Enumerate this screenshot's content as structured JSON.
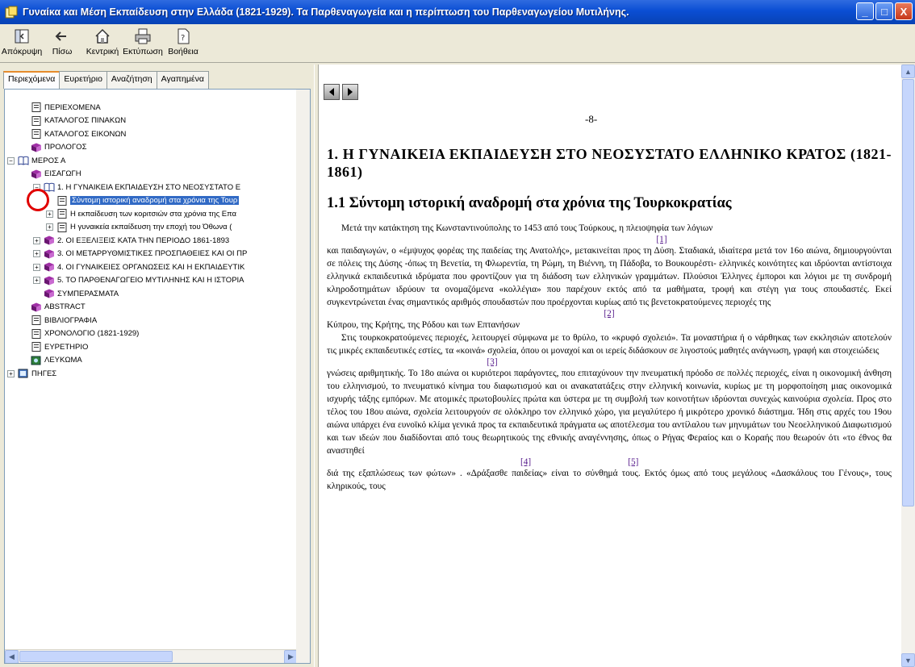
{
  "window": {
    "title": "Γυναίκα και Μέση Εκπαίδευση στην Ελλάδα (1821-1929). Τα Παρθεναγωγεία και η περίπτωση του Παρθεναγωγείου Μυτιλήνης.",
    "buttons": [
      "_",
      "□",
      "X"
    ]
  },
  "toolbar": [
    {
      "label": "Απόκρυψη",
      "icon": "hide-icon"
    },
    {
      "label": "Πίσω",
      "icon": "back-icon"
    },
    {
      "label": "Κεντρική",
      "icon": "home-icon"
    },
    {
      "label": "Εκτύπωση",
      "icon": "print-icon"
    },
    {
      "label": "Βοήθεια",
      "icon": "help-icon"
    }
  ],
  "tabs": [
    "Περιεχόμενα",
    "Ευρετήριο",
    "Αναζήτηση",
    "Αγαπημένα"
  ],
  "tree": [
    {
      "label": "ΠΕΡΙΕΧΟΜΕΝΑ",
      "icon": "page-icon"
    },
    {
      "label": "ΚΑΤΑΛΟΓΟΣ ΠΙΝΑΚΩΝ",
      "icon": "page-icon"
    },
    {
      "label": "ΚΑΤΑΛΟΓΟΣ ΕΙΚΟΝΩΝ",
      "icon": "page-icon"
    },
    {
      "label": "ΠΡΟΛΟΓΟΣ",
      "icon": "book-icon"
    },
    {
      "label": "ΜΕΡΟΣ Α",
      "icon": "open-book-icon",
      "expander": "−"
    },
    {
      "label": "ΕΙΣΑΓΩΓΗ",
      "icon": "book-icon"
    },
    {
      "label": "1. Η ΓΥΝΑΙΚΕΙΑ ΕΚΠΑΙΔΕΥΣΗ ΣΤΟ ΝΕΟΣΥΣΤΑΤΟ Ε",
      "icon": "open-book-icon",
      "expander": "−"
    },
    {
      "label": "Σύντομη ιστορική αναδρομή στα χρόνια της Τουρ",
      "icon": "page-icon",
      "selected": true
    },
    {
      "label": "Η εκπαίδευση των κοριτσιών στα χρόνια της Επα",
      "icon": "page-icon",
      "expander": "+"
    },
    {
      "label": "Η γυναικεία εκπαίδευση την εποχή του Όθωνα (",
      "icon": "page-icon",
      "expander": "+"
    },
    {
      "label": "2. ΟΙ ΕΞΕΛΙΞΕΙΣ ΚΑΤΑ ΤΗΝ ΠΕΡΙΟΔΟ 1861-1893",
      "icon": "book-icon",
      "expander": "+"
    },
    {
      "label": "3. ΟΙ ΜΕΤΑΡΡΥΘΜΙΣΤΙΚΕΣ ΠΡΟΣΠΑΘΕΙΕΣ ΚΑΙ ΟΙ ΠΡ",
      "icon": "book-icon",
      "expander": "+"
    },
    {
      "label": "4. ΟΙ ΓΥΝΑΙΚΕΙΕΣ ΟΡΓΑΝΩΣΕΙΣ ΚΑΙ Η ΕΚΠΑΙΔΕΥΤΙΚ",
      "icon": "book-icon",
      "expander": "+"
    },
    {
      "label": "5. ΤΟ ΠΑΡΘΕΝΑΓΩΓΕΙΟ ΜΥΤΙΛΗΝΗΣ ΚΑΙ Η ΙΣΤΟΡΙΑ",
      "icon": "book-icon",
      "expander": "+"
    },
    {
      "label": "ΣΥΜΠΕΡΑΣΜΑΤΑ",
      "icon": "book-icon"
    },
    {
      "label": "ABSTRACT",
      "icon": "book-icon"
    },
    {
      "label": "ΒΙΒΛΙΟΓΡΑΦΙΑ",
      "icon": "page-icon"
    },
    {
      "label": "ΧΡΟΝΟΛΟΓΙΟ (1821-1929)",
      "icon": "page-icon"
    },
    {
      "label": "ΕΥΡΕΤΗΡΙΟ",
      "icon": "page-icon"
    },
    {
      "label": "ΛΕΥΚΩΜΑ",
      "icon": "album-icon"
    },
    {
      "label": "ΠΗΓΕΣ",
      "icon": "sources-icon",
      "expander": "+"
    }
  ],
  "document": {
    "page_number": "-8-",
    "heading1": "1. Η ΓΥΝΑΙΚΕΙΑ ΕΚΠΑΙΔΕΥΣΗ ΣΤΟ ΝΕΟΣΥΣΤΑΤΟ ΕΛΛΗΝΙΚΟ ΚΡΑΤΟΣ (1821-1861)",
    "heading2": "1.1 Σύντομη ιστορική αναδρομή στα χρόνια της Τουρκοκρατίας",
    "p1": "Μετά την κατάκτηση της Κωνσταντινούπολης το 1453 από τους Τούρκους, η πλειοψηφία των λόγιων",
    "fn1": "[1]",
    "p2": "και παιδαγωγών, ο «έμψυχος φορέας της παιδείας της Ανατολής», μετακινείται προς τη Δύση. Σταδιακά, ιδιαίτερα μετά τον 16ο αιώνα, δημιουργούνται σε πόλεις της Δύσης -όπως τη Βενετία, τη Φλωρεντία, τη Ρώμη, τη Βιέννη, τη Πάδοβα, το Βουκουρέστι- ελληνικές κοινότητες και ιδρύονται αντίστοιχα ελληνικά εκπαιδευτικά ιδρύματα που φροντίζουν για τη διάδοση των ελληνικών γραμμάτων. Πλούσιοι Έλληνες έμποροι και λόγιοι με τη συνδρομή κληροδοτημάτων ιδρύουν τα ονομαζόμενα «κολλέγια» που παρέχουν εκτός από τα μαθήματα, τροφή και στέγη για τους σπουδαστές. Εκεί συγκεντρώνεται ένας σημαντικός αριθμός σπουδαστών που προέρχονται κυρίως από τις βενετοκρατούμενες περιοχές της",
    "fn2": "[2]",
    "p3": "Κύπρου, της Κρήτης, της Ρόδου και των Επτανήσων",
    "p4": "Στις τουρκοκρατούμενες περιοχές, λειτουργεί σύμφωνα με το θρύλο, το «κρυφό σχολειό». Τα μοναστήρια ή ο νάρθηκας των εκκλησιών αποτελούν τις μικρές εκπαιδευτικές εστίες, τα «κοινά» σχολεία, όπου οι μοναχοί και οι ιερείς διδάσκουν σε λιγοστούς μαθητές ανάγνωση, γραφή και στοιχειώδεις",
    "fn3": "[3]",
    "p5": "γνώσεις αριθμητικής. Το 18ο αιώνα οι κυριότεροι παράγοντες, που επιταχύνουν την πνευματική πρόοδο σε πολλές περιοχές, είναι η οικονομική άνθηση του ελληνισμού, το πνευματικό κίνημα του διαφωτισμού και οι ανακατατάξεις στην ελληνική κοινωνία, κυρίως με τη μορφοποίηση μιας οικονομικά ισχυρής τάξης εμπόρων. Με ατομικές πρωτοβουλίες πρώτα και ύστερα με τη συμβολή των κοινοτήτων ιδρύονται συνεχώς καινούρια σχολεία. Προς στο τέλος του 18ου αιώνα, σχολεία λειτουργούν σε ολόκληρο τον ελληνικό χώρο, για μεγαλύτερο ή μικρότερο χρονικό διάστημα. Ήδη στις αρχές του 19ου αιώνα υπάρχει ένα ευνοϊκό κλίμα γενικά προς τα εκπαιδευτικά πράγματα ως αποτέλεσμα του αντίλαλου των μηνυμάτων του Νεοελληνικού Διαφωτισμού και των ιδεών που διαδίδονται από τους θεωρητικούς της εθνικής αναγέννησης, όπως ο Ρήγας Φεραίος και ο Κοραής που θεωρούν ότι «το έθνος θα αναστηθεί",
    "fn4": "[4]",
    "fn5": "[5]",
    "p6": "διά της εξαπλώσεως των φώτων» . «Δράξασθε παιδείας» είναι το σύνθημά τους. Εκτός όμως από τους μεγάλους «Δασκάλους του Γένους», τους κληρικούς, τους"
  }
}
